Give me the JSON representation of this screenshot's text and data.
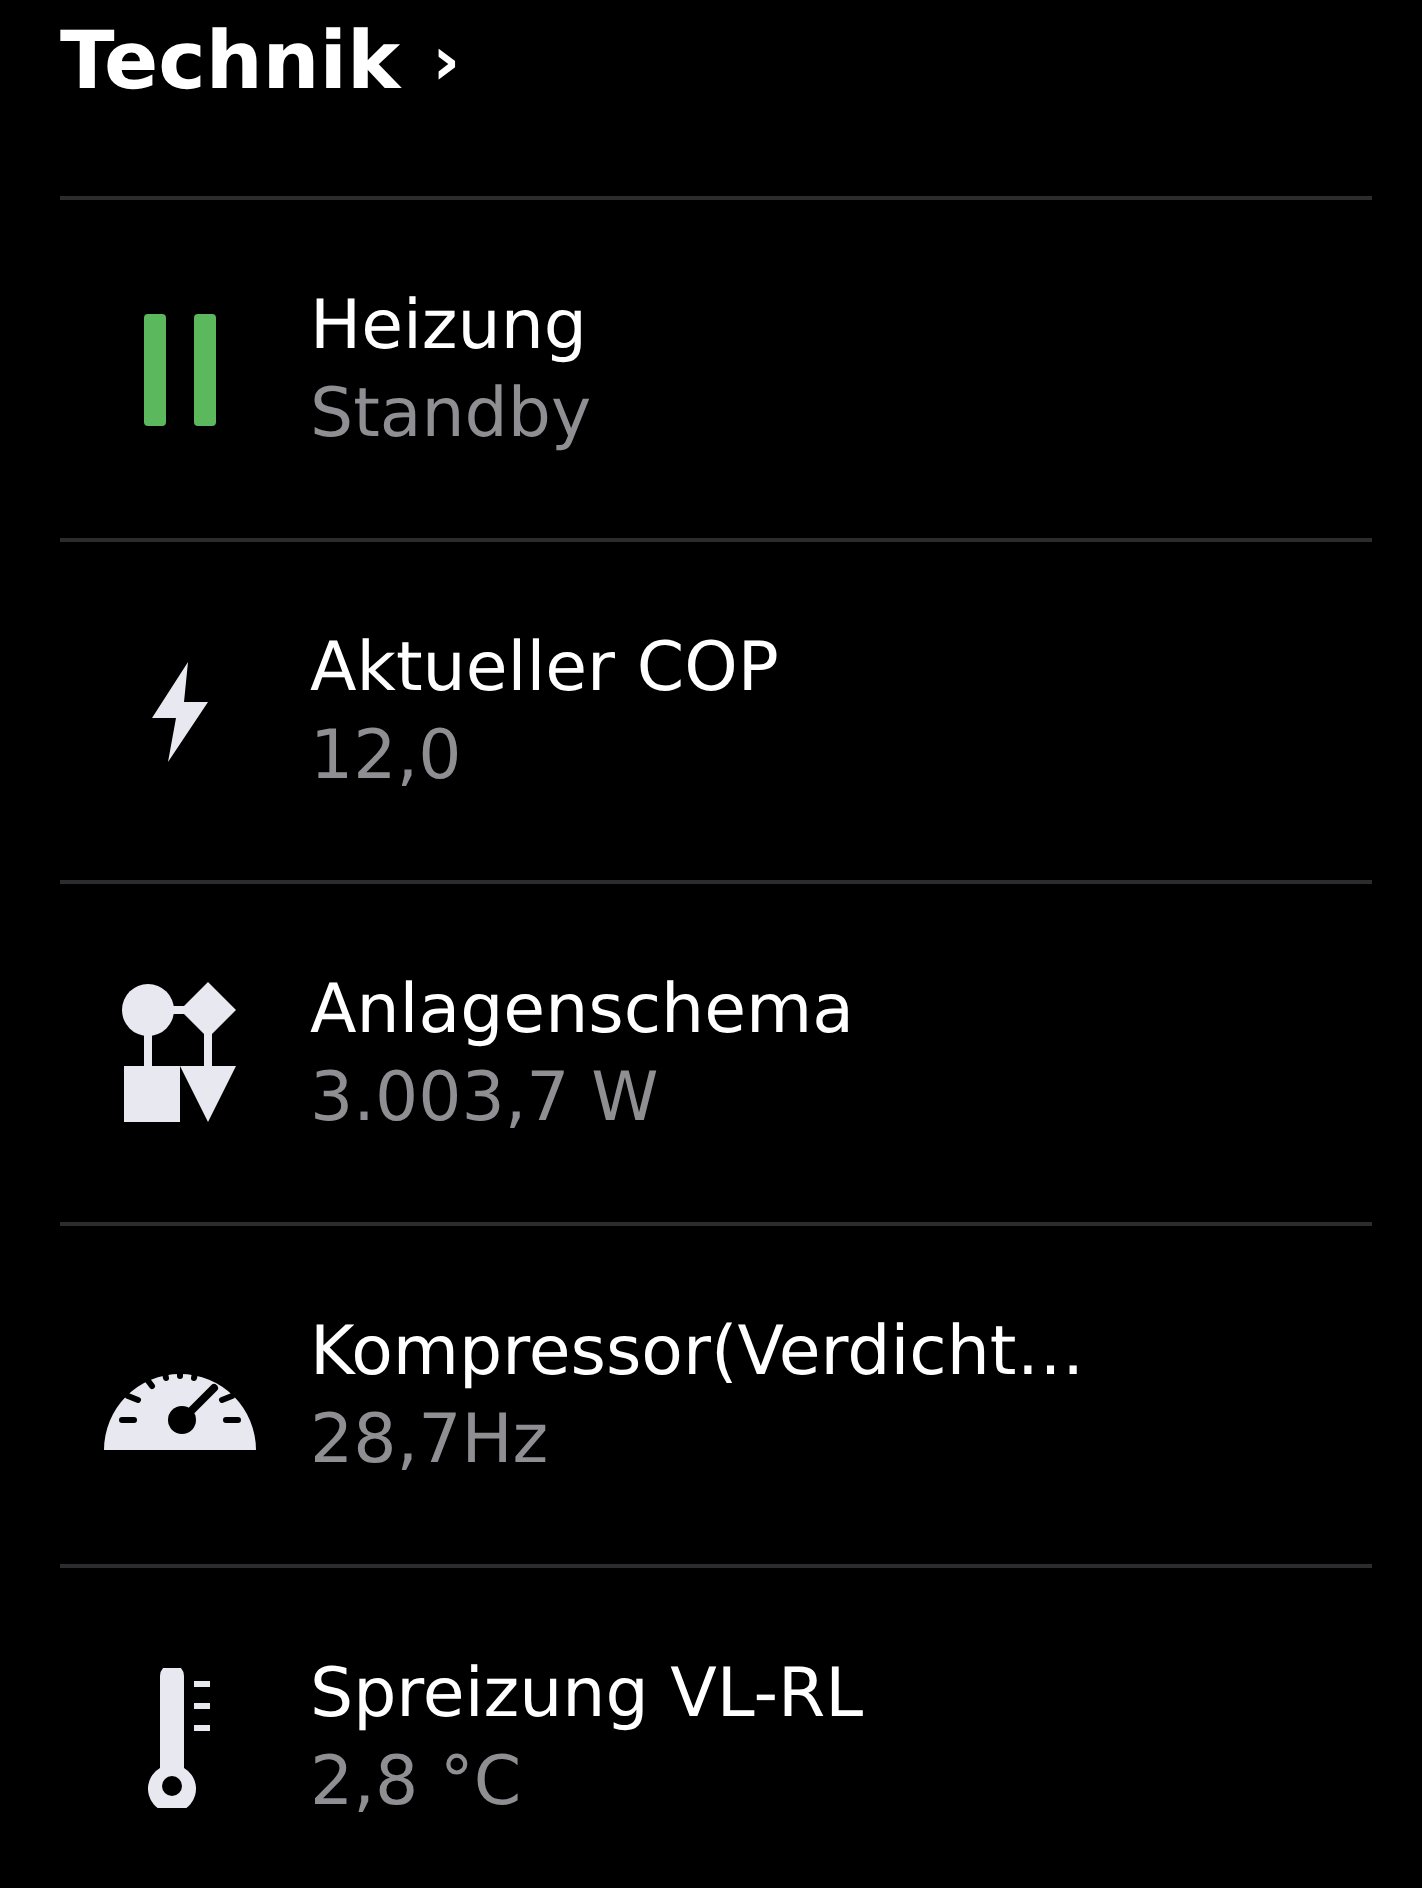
{
  "header": {
    "title": "Technik",
    "chevron": "›"
  },
  "items": [
    {
      "kind": "pause",
      "title": "Heizung",
      "value": "Standby"
    },
    {
      "kind": "bolt",
      "title": "Aktueller COP",
      "value": "12,0"
    },
    {
      "kind": "schema",
      "title": "Anlagenschema",
      "value": "3.003,7 W"
    },
    {
      "kind": "gauge",
      "title": "Kompressor(Verdicht…",
      "value": "28,7Hz"
    },
    {
      "kind": "thermometer",
      "title": "Spreizung VL-RL",
      "value": "2,8 °C"
    }
  ]
}
